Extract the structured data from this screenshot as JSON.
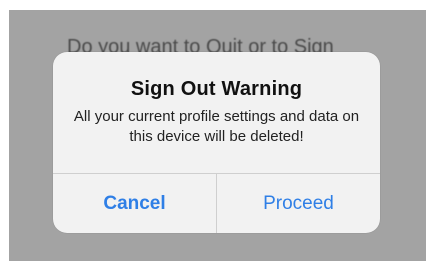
{
  "background": {
    "partial_text": "Do you want to Quit or to Sign"
  },
  "alert": {
    "title": "Sign Out Warning",
    "message": "All your current profile settings and data on this device will be deleted!",
    "actions": {
      "cancel_label": "Cancel",
      "proceed_label": "Proceed"
    },
    "accent_color": "#2f7fe6"
  }
}
